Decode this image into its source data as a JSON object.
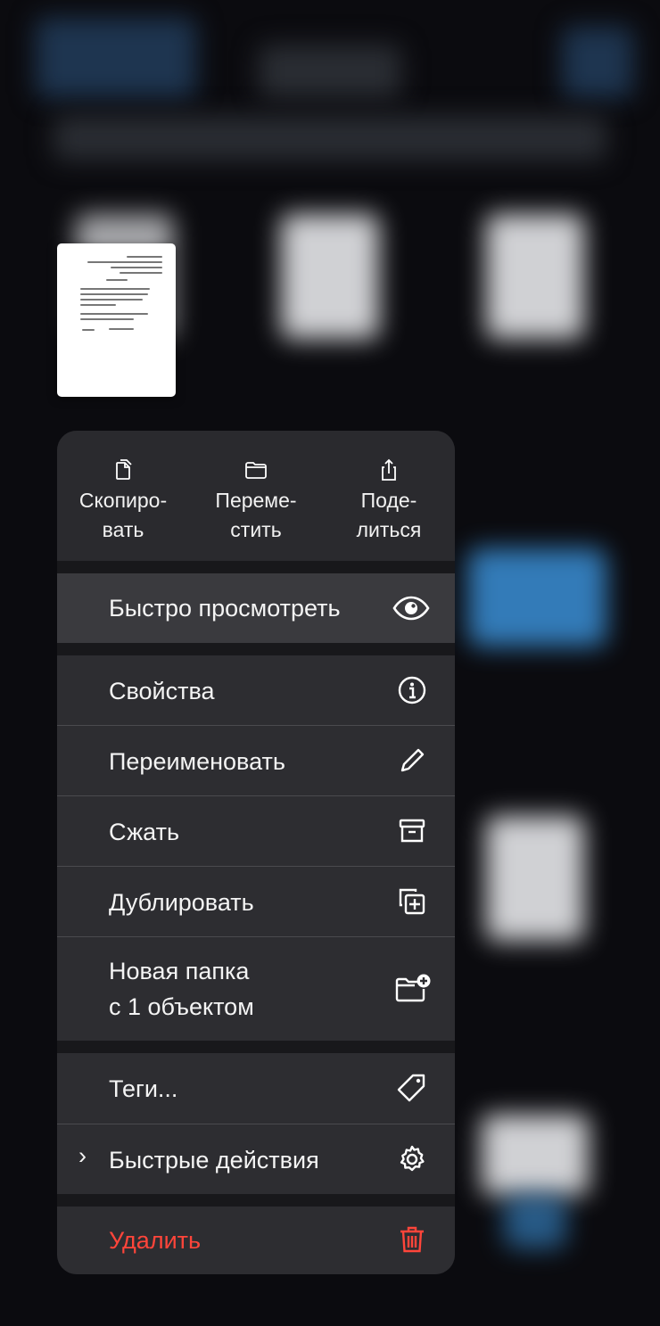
{
  "actions_top": [
    {
      "label": "Скопиро-\nвать",
      "icon": "copy-icon"
    },
    {
      "label": "Переме-\nстить",
      "icon": "folder-icon"
    },
    {
      "label": "Поде-\nлиться",
      "icon": "share-icon"
    }
  ],
  "menu": {
    "quick_look": {
      "label": "Быстро просмотреть",
      "icon": "eye-icon"
    },
    "info": {
      "label": "Свойства",
      "icon": "info-icon"
    },
    "rename": {
      "label": "Переименовать",
      "icon": "pencil-icon"
    },
    "compress": {
      "label": "Сжать",
      "icon": "archive-icon"
    },
    "duplicate": {
      "label": "Дублировать",
      "icon": "duplicate-icon"
    },
    "new_folder": {
      "label": "Новая папка\nс 1 объектом",
      "icon": "folder-plus-icon"
    },
    "tags": {
      "label": "Теги...",
      "icon": "tag-icon"
    },
    "quick_actions": {
      "label": "Быстрые действия",
      "icon": "gear-icon",
      "chevron": "›"
    },
    "delete": {
      "label": "Удалить",
      "icon": "trash-icon",
      "color": "#ff453a"
    }
  }
}
